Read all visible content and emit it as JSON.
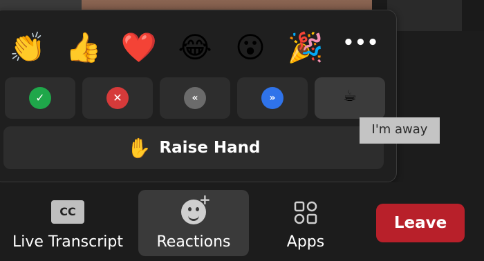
{
  "reactions": {
    "emojis": [
      "👏",
      "👍",
      "❤️",
      "😂",
      "😮",
      "🎉"
    ],
    "more_label": "•••"
  },
  "status": {
    "yes_symbol": "✓",
    "no_symbol": "✕",
    "slower_symbol": "«",
    "faster_symbol": "»",
    "away_symbol": "☕"
  },
  "raise_hand": {
    "icon": "✋",
    "label": "Raise Hand"
  },
  "tooltip": {
    "text": "I'm away"
  },
  "toolbar": {
    "live_transcript_icon_text": "CC",
    "live_transcript_label": "Live Transcript",
    "reactions_label": "Reactions",
    "apps_label": "Apps",
    "leave_label": "Leave"
  },
  "colors": {
    "leave_button": "#b8202a",
    "yes_green": "#1fa74a",
    "no_red": "#d63a3a",
    "faster_blue": "#2f73ea",
    "slower_gray": "#6b6b6b"
  }
}
